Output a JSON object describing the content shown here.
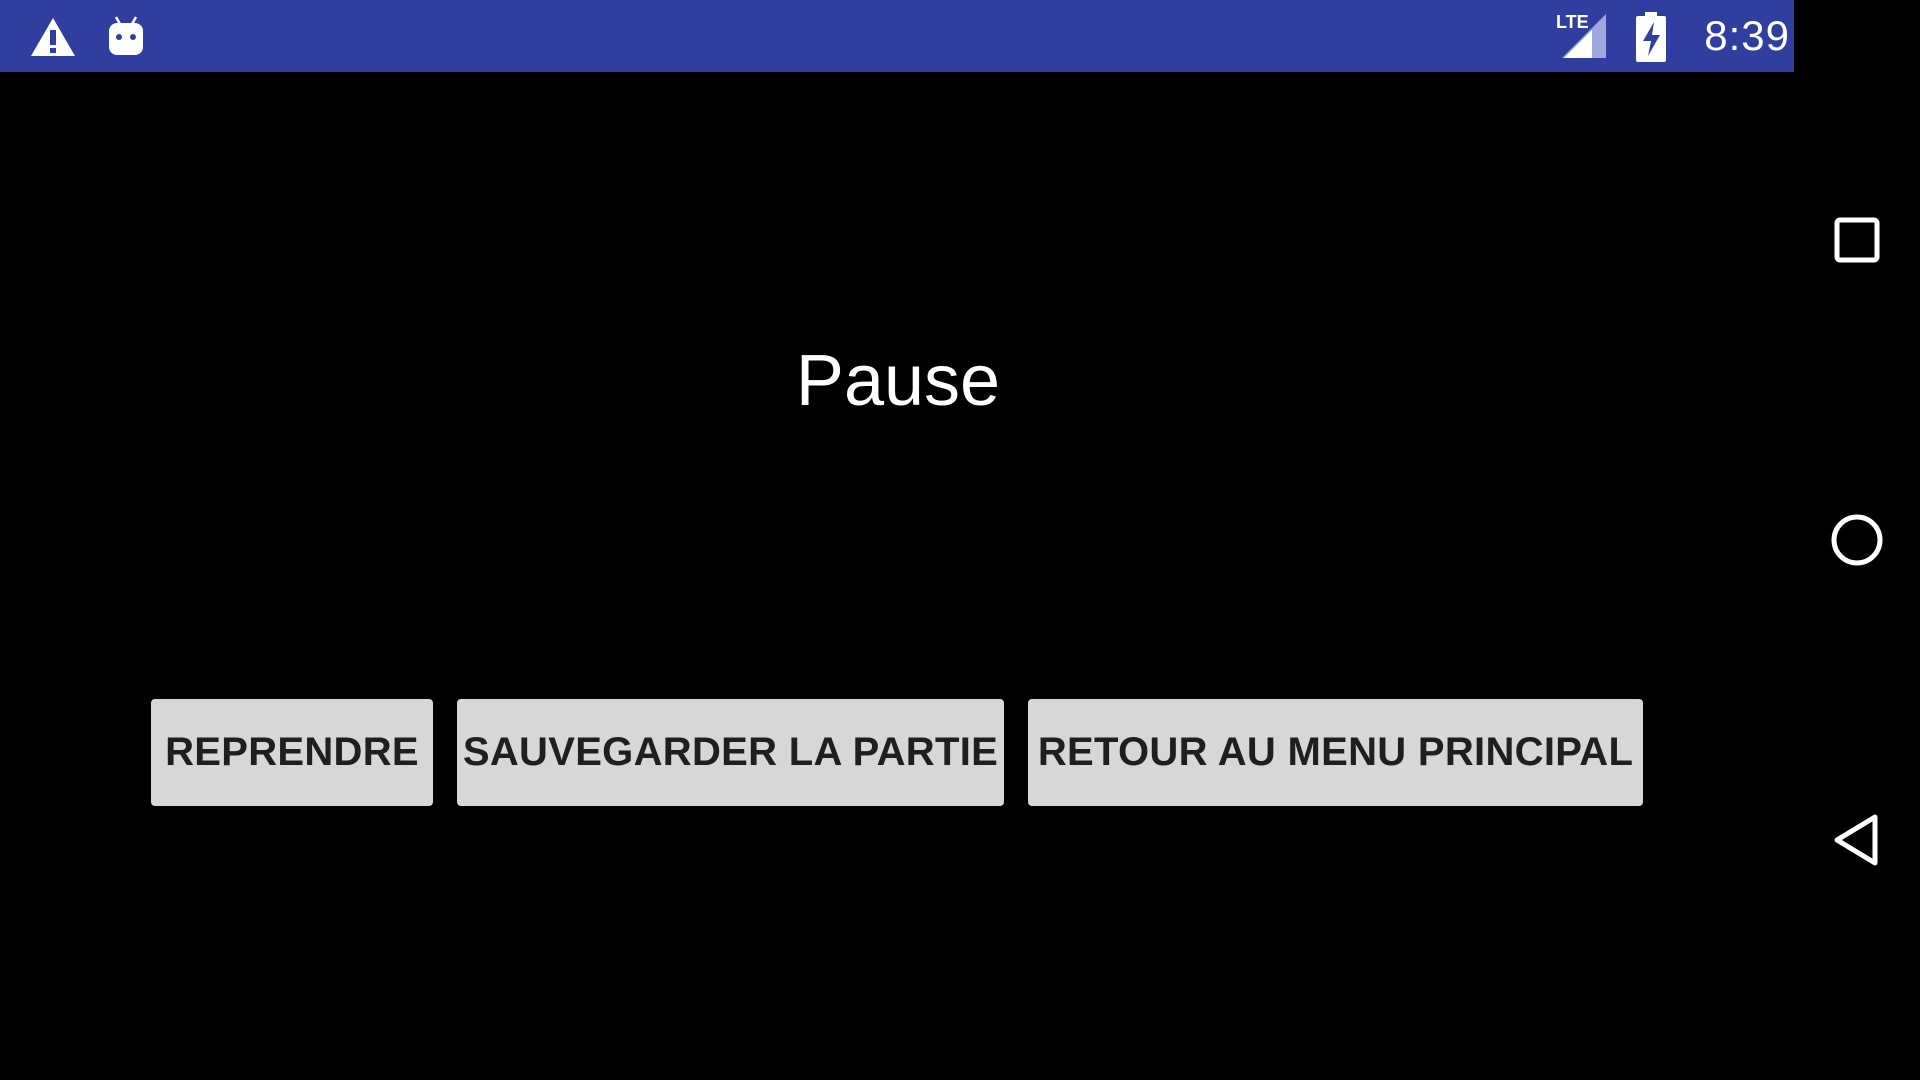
{
  "status_bar": {
    "background_color": "#303F9F",
    "left_icons": [
      "warning-icon",
      "android-debug-icon"
    ],
    "network_label": "LTE",
    "signal_icon": "lte-signal-icon",
    "battery_icon": "battery-charging-icon",
    "time": "8:39"
  },
  "pause_screen": {
    "title": "Pause",
    "buttons": {
      "resume": "REPRENDRE",
      "save_game": "SAUVEGARDER LA PARTIE",
      "main_menu": "RETOUR AU MENU PRINCIPAL"
    },
    "button_color": "#D6D7D7"
  },
  "nav_bar": {
    "items": [
      "recents-icon",
      "home-icon",
      "back-icon"
    ]
  }
}
